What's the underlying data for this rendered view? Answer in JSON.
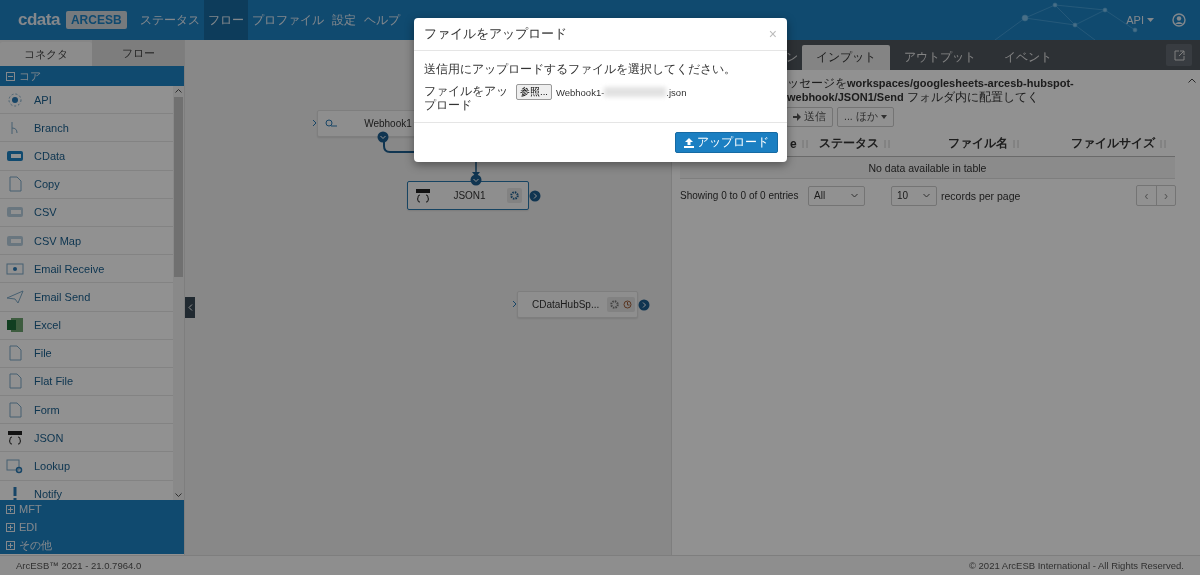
{
  "header": {
    "logo": {
      "brand": "cdata",
      "product": "ARCESB"
    },
    "nav": [
      {
        "label": "ステータス",
        "selected": false
      },
      {
        "label": "フロー",
        "selected": true
      },
      {
        "label": "プロファイル",
        "selected": false
      },
      {
        "label": "設定",
        "selected": false
      },
      {
        "label": "ヘルプ",
        "selected": false
      }
    ],
    "user_menu": "API"
  },
  "sidebar": {
    "tabs": [
      {
        "label": "コネクタ",
        "selected": true
      },
      {
        "label": "フロー",
        "selected": false
      }
    ],
    "categories": [
      {
        "label": "コア",
        "expanded": true,
        "items": [
          {
            "label": "API",
            "kind": "api"
          },
          {
            "label": "Branch",
            "kind": "branch"
          },
          {
            "label": "CData",
            "kind": "cdata"
          },
          {
            "label": "Copy",
            "kind": "copy"
          },
          {
            "label": "CSV",
            "kind": "csv"
          },
          {
            "label": "CSV Map",
            "kind": "csvmap"
          },
          {
            "label": "Email Receive",
            "kind": "mailin"
          },
          {
            "label": "Email Send",
            "kind": "mailout"
          },
          {
            "label": "Excel",
            "kind": "excel"
          },
          {
            "label": "File",
            "kind": "file"
          },
          {
            "label": "Flat File",
            "kind": "flatfile"
          },
          {
            "label": "Form",
            "kind": "form"
          },
          {
            "label": "JSON",
            "kind": "json"
          },
          {
            "label": "Lookup",
            "kind": "lookup"
          },
          {
            "label": "Notify",
            "kind": "notify"
          }
        ]
      },
      {
        "label": "MFT",
        "expanded": false
      },
      {
        "label": "EDI",
        "expanded": false
      },
      {
        "label": "その他",
        "expanded": false
      }
    ]
  },
  "canvas": {
    "nodes": [
      {
        "label": "Webhook1",
        "kind": "webhook",
        "selected": false
      },
      {
        "label": "JSON1",
        "kind": "json",
        "selected": true
      },
      {
        "label": "CDataHubSp...",
        "kind": "cdata",
        "selected": false
      }
    ]
  },
  "right_panel": {
    "tabs": [
      {
        "label": "ン",
        "selected": false
      },
      {
        "label": "インプット",
        "selected": true
      },
      {
        "label": "アウトプット",
        "selected": false
      },
      {
        "label": "イベント",
        "selected": false
      }
    ],
    "message": "ッセージを**workspaces/googlesheets-arcesb-hubspot-webhook/JSON1/Send** フォルダ内に配置してく",
    "toolbar": [
      "送信",
      "... ほか"
    ],
    "table": {
      "columns": [
        "e",
        "ステータス",
        "ファイル名",
        "ファイルサイズ"
      ],
      "empty_message": "No data available in table"
    },
    "info": "Showing 0 to 0 of 0 entries",
    "filter_select": "All",
    "page_size": "10",
    "page_size_label": "records per page",
    "pagination": [
      "‹",
      "›"
    ]
  },
  "modal": {
    "title": "ファイルをアップロード",
    "close": "×",
    "instruction": "送信用にアップロードするファイルを選択してください。",
    "field_label": "ファイルをアップロード",
    "browse_button": "参照...",
    "file_name_prefix": "Webhook1-",
    "file_name_suffix": ".json",
    "submit": "アップロード"
  },
  "footer": {
    "version": "ArcESB™ 2021 - 21.0.7964.0",
    "copyright": "© 2021 ArcESB International - All Rights Reserved."
  }
}
